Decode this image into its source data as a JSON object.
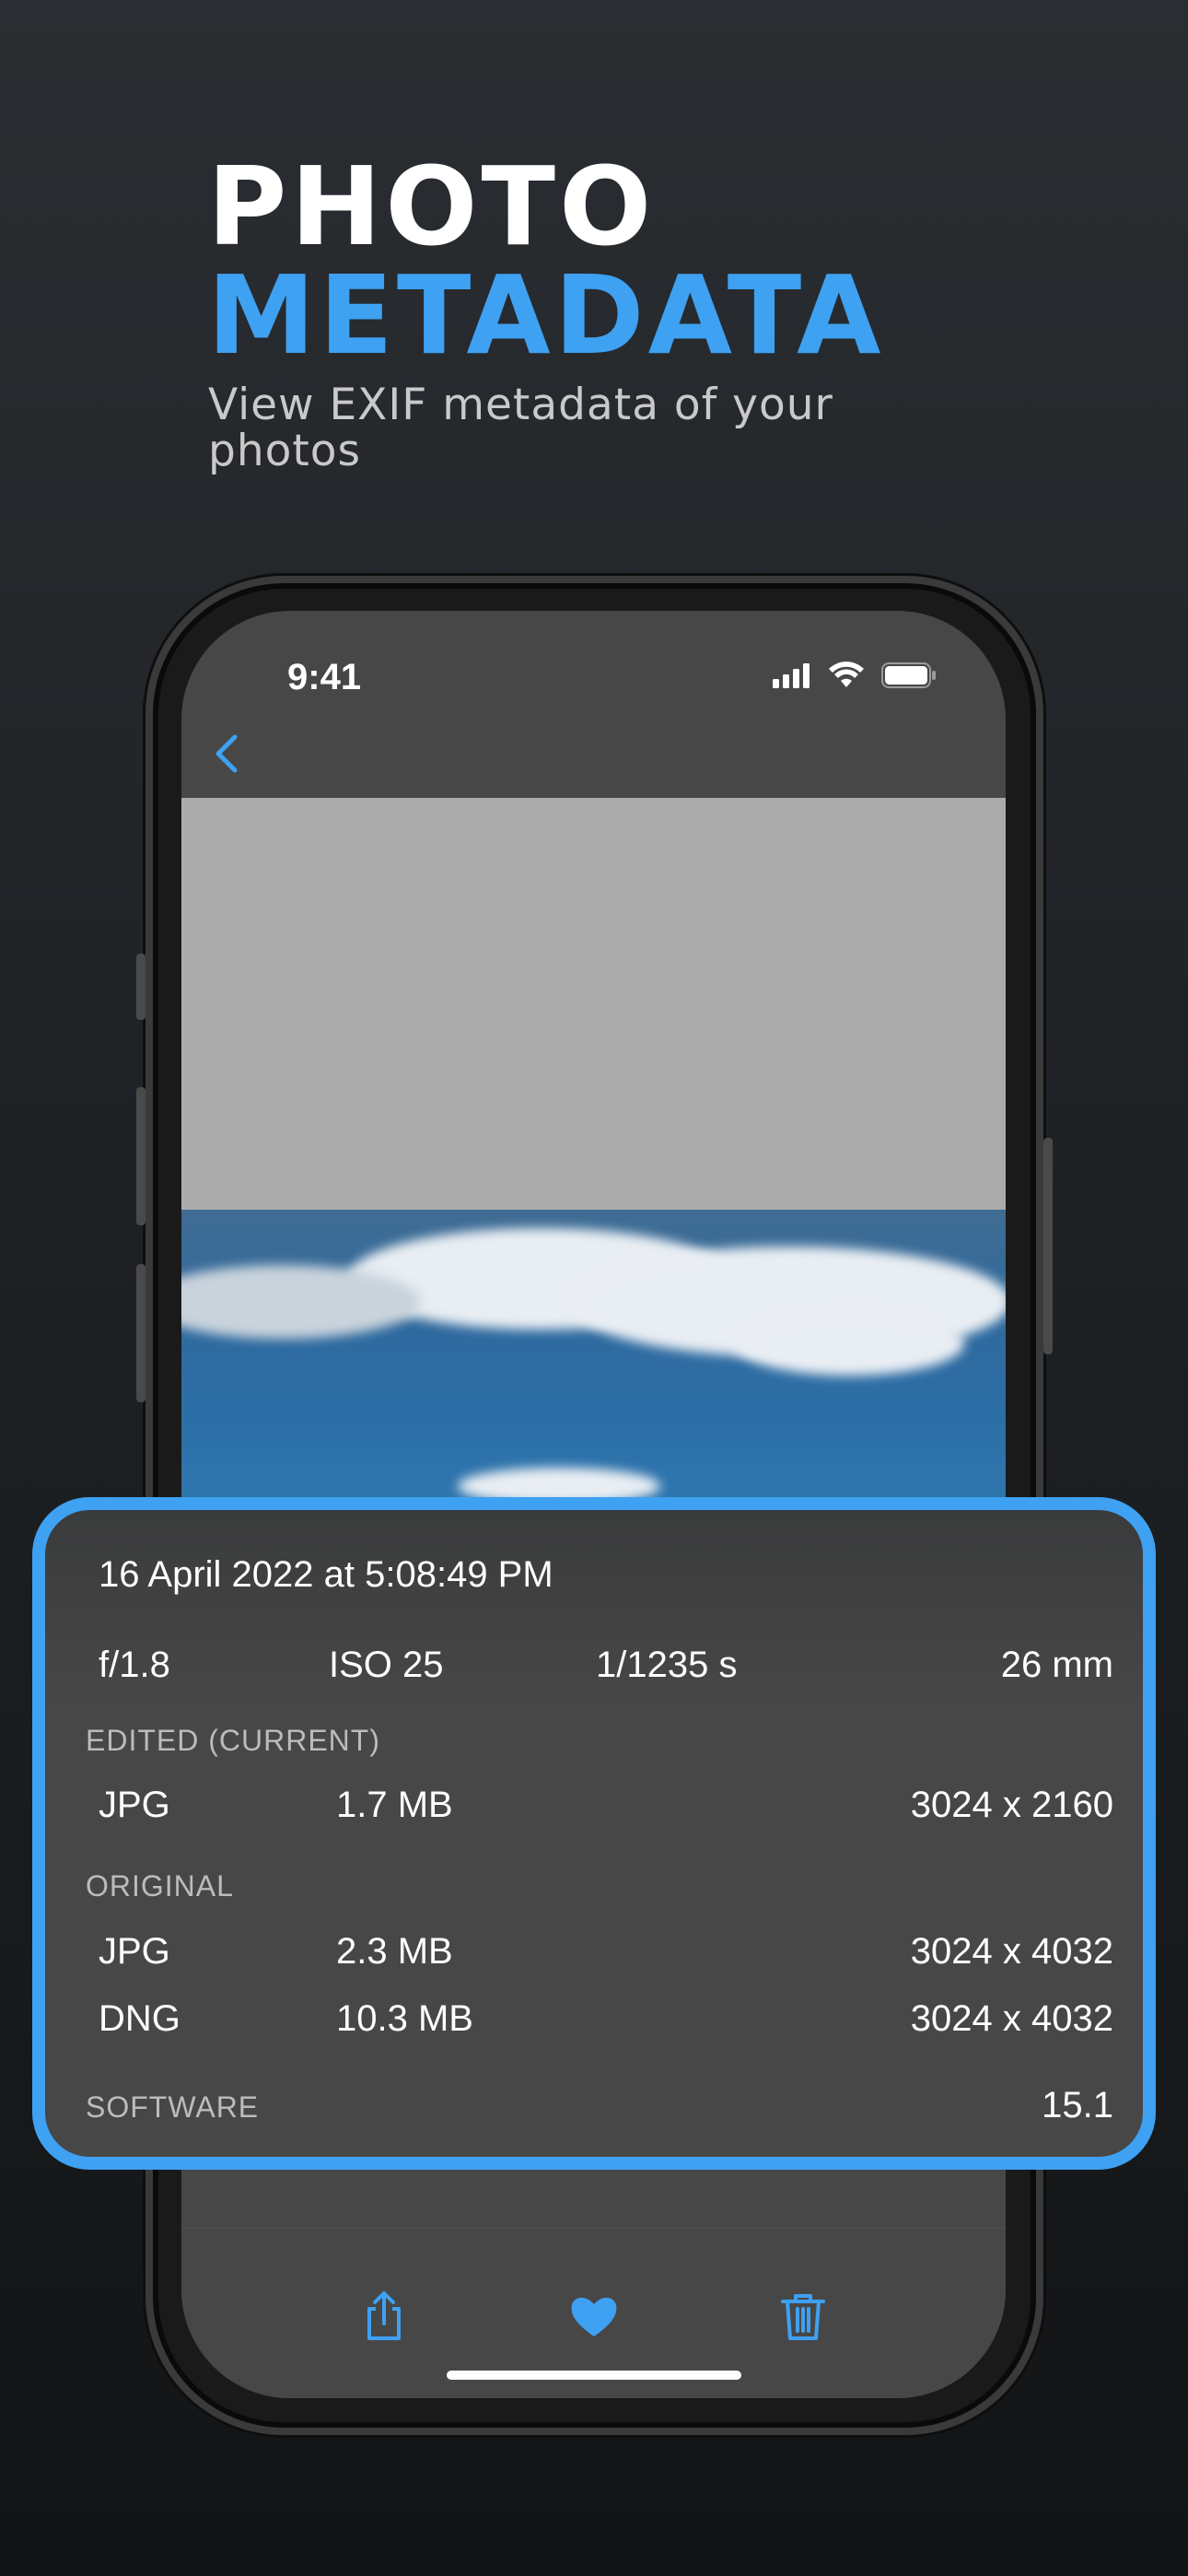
{
  "promo": {
    "title_line1": "PHOTO",
    "title_line2": "METADATA",
    "subtitle": "View EXIF metadata of your photos"
  },
  "status_bar": {
    "time": "9:41"
  },
  "metadata": {
    "date": "16 April 2022 at 5:08:49 PM",
    "exposure": {
      "aperture": "f/1.8",
      "iso": "ISO 25",
      "shutter": "1/1235 s",
      "focal_length": "26 mm"
    },
    "edited_section": "EDITED (CURRENT)",
    "edited": [
      {
        "format": "JPG",
        "size": "1.7 MB",
        "dimensions": "3024 x 2160"
      }
    ],
    "original_section": "ORIGINAL",
    "original": [
      {
        "format": "JPG",
        "size": "2.3 MB",
        "dimensions": "3024 x 4032"
      },
      {
        "format": "DNG",
        "size": "10.3 MB",
        "dimensions": "3024 x 4032"
      }
    ],
    "software_label": "SOFTWARE",
    "software_version": "15.1"
  },
  "colors": {
    "accent": "#3ea1f2",
    "background": "#1c1f22",
    "screen": "#474747"
  },
  "icons": {
    "back": "chevron-left-icon",
    "share": "share-icon",
    "favorite": "heart-icon",
    "delete": "trash-icon"
  }
}
